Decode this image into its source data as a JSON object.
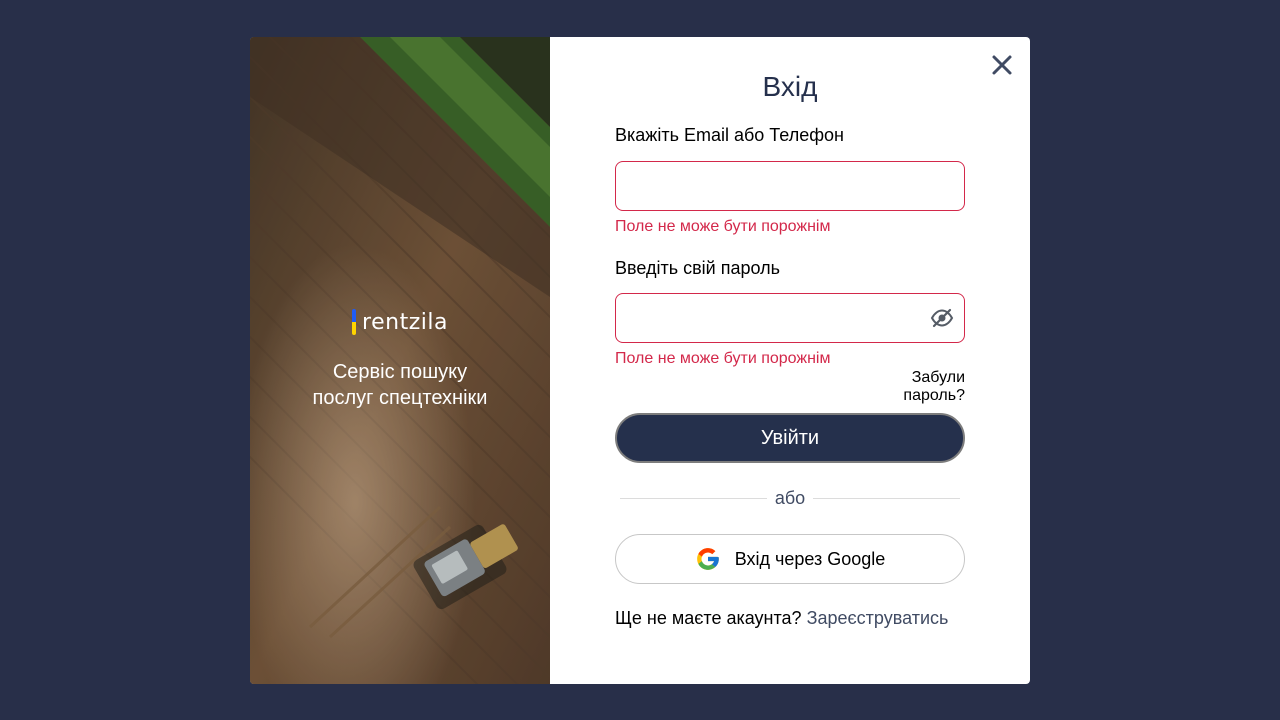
{
  "hero": {
    "brand_name": "rentzila",
    "tagline_line1": "Сервіс пошуку",
    "tagline_line2": "послуг спецтехніки"
  },
  "login": {
    "title": "Вхід",
    "close_icon": "close-icon",
    "login_field": {
      "label": "Вкажіть Email або Телефон",
      "value": "",
      "error": "Поле не може бути порожнім"
    },
    "password_field": {
      "label": "Введіть свій пароль",
      "value": "",
      "error": "Поле не може бути порожнім",
      "toggle_icon": "eye-off-icon"
    },
    "forgot_password": "Забули пароль?",
    "submit_label": "Увійти",
    "divider_text": "або",
    "google_button": {
      "icon": "google-icon",
      "label": "Вхід через Google"
    },
    "signup_prompt": "Ще не маєте акаунта?",
    "signup_link": "Зареєструватись"
  },
  "colors": {
    "backdrop": "#282f49",
    "primary": "#25304c",
    "error": "#d3284a",
    "link": "#404b63"
  }
}
